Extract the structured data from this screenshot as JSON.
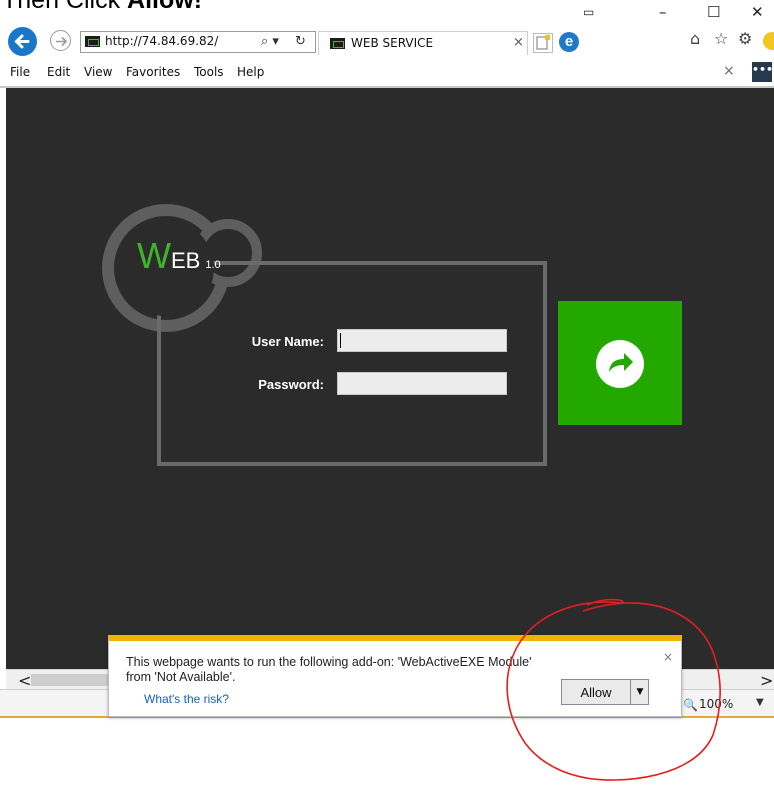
{
  "instruction": {
    "prefix": "Then Click ",
    "action": "Allow!"
  },
  "window_controls": {
    "minimize": "–",
    "maximize": "☐",
    "close": "✕"
  },
  "address_bar": {
    "url": "http://74.84.69.82/",
    "search_glyph": "⌕ ▾",
    "refresh_glyph": "↻"
  },
  "tab": {
    "title": "WEB SERVICE",
    "close_glyph": "×"
  },
  "toolbar_right": {
    "home": "⌂",
    "favorites": "☆",
    "settings": "⚙"
  },
  "menu": {
    "items": [
      "File",
      "Edit",
      "View",
      "Favorites",
      "Tools",
      "Help"
    ],
    "close_glyph": "×",
    "more_glyph": "•••"
  },
  "logo": {
    "w": "W",
    "eb": "EB",
    "version": "1.0"
  },
  "login": {
    "username_label": "User Name:",
    "password_label": "Password:",
    "username_value": "",
    "password_value": ""
  },
  "scrollbar": {
    "left_arrow": "<",
    "right_arrow": ">"
  },
  "status": {
    "zoom_icon": "🔍",
    "zoom": "100%",
    "zoom_dropdown": "▼"
  },
  "notification": {
    "message": "This webpage wants to run the following add-on: 'WebActiveEXE Module' from 'Not Available'.",
    "link": "What's the risk?",
    "allow_label": "Allow",
    "dropdown_glyph": "▼",
    "close_glyph": "×"
  },
  "colors": {
    "accent_green": "#23a800",
    "logo_green": "#41b52a",
    "ie_blue": "#1976c8",
    "notif_yellow": "#f0b400",
    "annotation_red": "#e0201f",
    "page_bg": "#2b2b2b"
  }
}
